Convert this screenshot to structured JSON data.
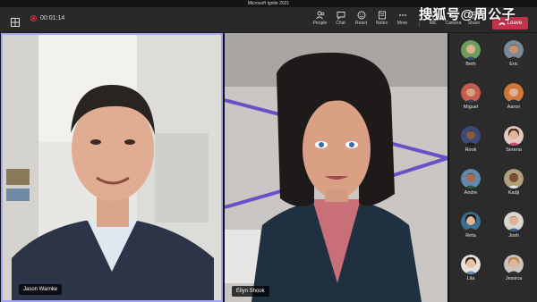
{
  "window": {
    "title": "Microsoft Ignite 2021"
  },
  "toolbar": {
    "timer": "00:01:14",
    "buttons": [
      {
        "id": "people",
        "label": "People",
        "icon": "people-icon"
      },
      {
        "id": "chat",
        "label": "Chat",
        "icon": "chat-icon"
      },
      {
        "id": "react",
        "label": "React",
        "icon": "react-icon"
      },
      {
        "id": "notes",
        "label": "Notes",
        "icon": "notes-icon"
      },
      {
        "id": "more",
        "label": "More",
        "icon": "more-icon"
      },
      {
        "id": "mic",
        "label": "Mic",
        "icon": "mic-icon"
      },
      {
        "id": "camera",
        "label": "Camera",
        "icon": "camera-icon"
      },
      {
        "id": "share",
        "label": "Share",
        "icon": "share-icon"
      }
    ],
    "leave_label": "Leave",
    "leave_color": "#c4314b"
  },
  "stage": {
    "tiles": [
      {
        "name": "Jason Warnke",
        "active": true,
        "accent": "#a4a6f0"
      },
      {
        "name": "Ellyn Shook",
        "active": false
      }
    ]
  },
  "roster": [
    {
      "name": "Beth"
    },
    {
      "name": "Eric"
    },
    {
      "name": "Miguel"
    },
    {
      "name": "Aaron"
    },
    {
      "name": "Rook"
    },
    {
      "name": "Serena"
    },
    {
      "name": "Andre"
    },
    {
      "name": "Kadji"
    },
    {
      "name": "Reta"
    },
    {
      "name": "Josh"
    },
    {
      "name": "Lila"
    },
    {
      "name": "Jessica"
    }
  ],
  "watermark": "搜狐号@周公子"
}
